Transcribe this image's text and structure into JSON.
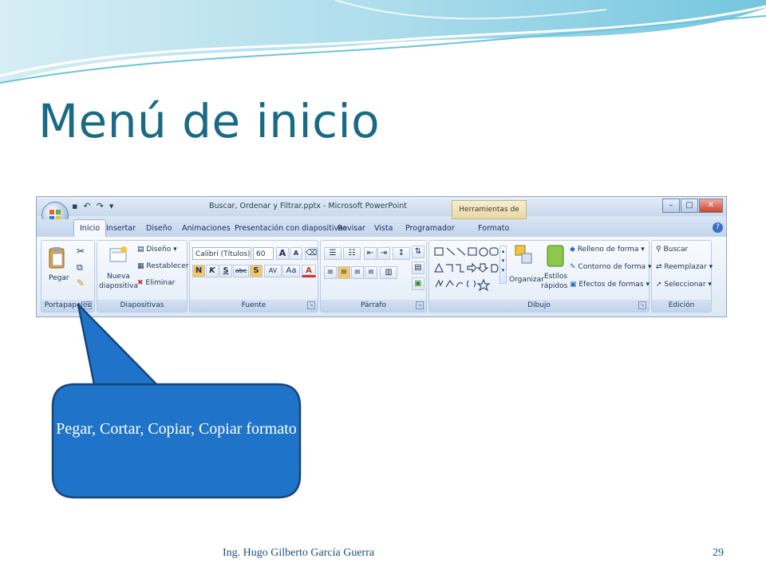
{
  "slide": {
    "title": "Menú de inicio",
    "footer": "Ing. Hugo Gilberto García Guerra",
    "page_number": "29",
    "callout": "Pegar, Cortar, Copiar, Copiar formato"
  },
  "ribbon": {
    "window_title": "Buscar, Ordenar y Filtrar.pptx - Microsoft PowerPoint",
    "contextual_tab": "Herramientas de dibujo",
    "window_buttons": [
      "–",
      "□",
      "✕"
    ],
    "tabs": [
      "Inicio",
      "Insertar",
      "Diseño",
      "Animaciones",
      "Presentación con diapositivas",
      "Revisar",
      "Vista",
      "Programador",
      "Formato"
    ],
    "groups": {
      "portapapeles": {
        "label": "Portapapeles",
        "paste": "Pegar"
      },
      "diapositivas": {
        "label": "Diapositivas",
        "new_slide_1": "Nueva",
        "new_slide_2": "diapositiva",
        "layout": "Diseño",
        "reset": "Restablecer",
        "delete": "Eliminar"
      },
      "fuente": {
        "label": "Fuente",
        "font_name": "Calibri (Títulos)",
        "font_size": "60",
        "bold": "N",
        "italic": "K",
        "underline": "S",
        "strike": "abc",
        "shadow": "S",
        "spacing": "AV",
        "case": "Aa",
        "color": "A",
        "grow": "A",
        "shrink": "A"
      },
      "parrafo": {
        "label": "Párrafo"
      },
      "dibujo": {
        "label": "Dibujo",
        "arrange": "Organizar",
        "quick_styles_1": "Estilos",
        "quick_styles_2": "rápidos",
        "fill": "Relleno de forma",
        "outline": "Contorno de forma",
        "effects": "Efectos de formas"
      },
      "edicion": {
        "label": "Edición",
        "find": "Buscar",
        "replace": "Reemplazar",
        "select": "Seleccionar"
      }
    }
  }
}
